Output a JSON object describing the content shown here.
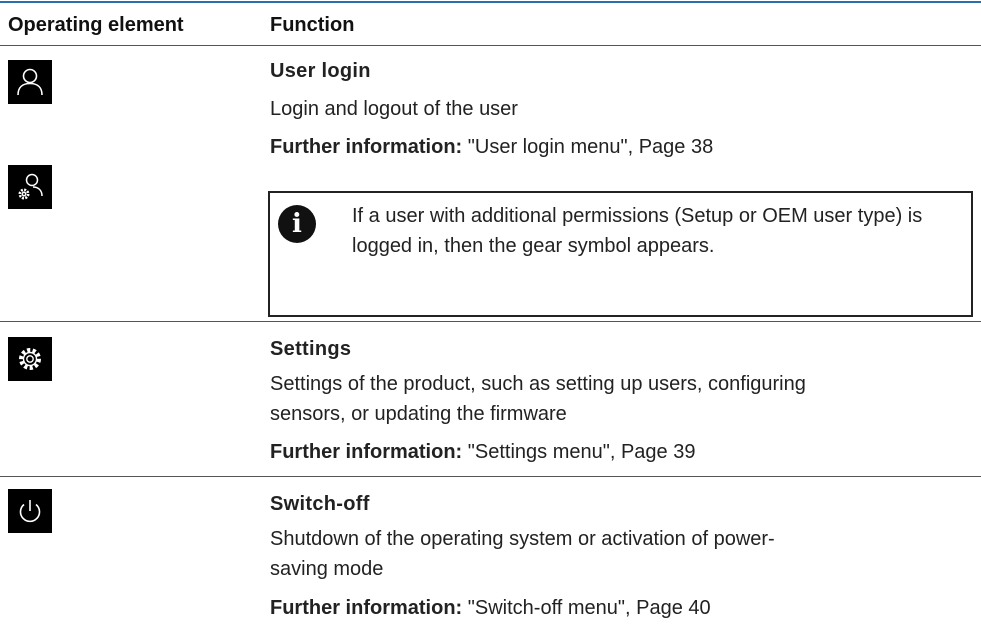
{
  "table": {
    "headers": {
      "col1": "Operating element",
      "col2": "Function"
    }
  },
  "rows": {
    "user_login": {
      "title": "User login",
      "desc": "Login and logout of the user",
      "further_label": "Further information:",
      "further_ref": " \"User login menu\", Page 38",
      "note": "If a user with additional permissions (Setup or OEM user type) is logged in, then the gear symbol appears."
    },
    "settings": {
      "title": "Settings",
      "desc_line1": "Settings of the product, such as setting up users, configuring",
      "desc_line2": "sensors, or updating the firmware",
      "further_label": "Further information:",
      "further_ref": " \"Settings menu\", Page 39"
    },
    "switch_off": {
      "title": "Switch-off",
      "desc_line1": "Shutdown of the operating system or activation of power-",
      "desc_line2": "saving mode",
      "further_label": "Further information:",
      "further_ref": " \"Switch-off menu\", Page 40"
    }
  },
  "icons": {
    "user": "user-icon",
    "user_gear": "user-gear-icon",
    "settings": "gear-icon",
    "power": "power-icon",
    "info": "info-icon"
  },
  "colors": {
    "top_rule": "#2a6fb0",
    "icon_bg": "#000000"
  }
}
